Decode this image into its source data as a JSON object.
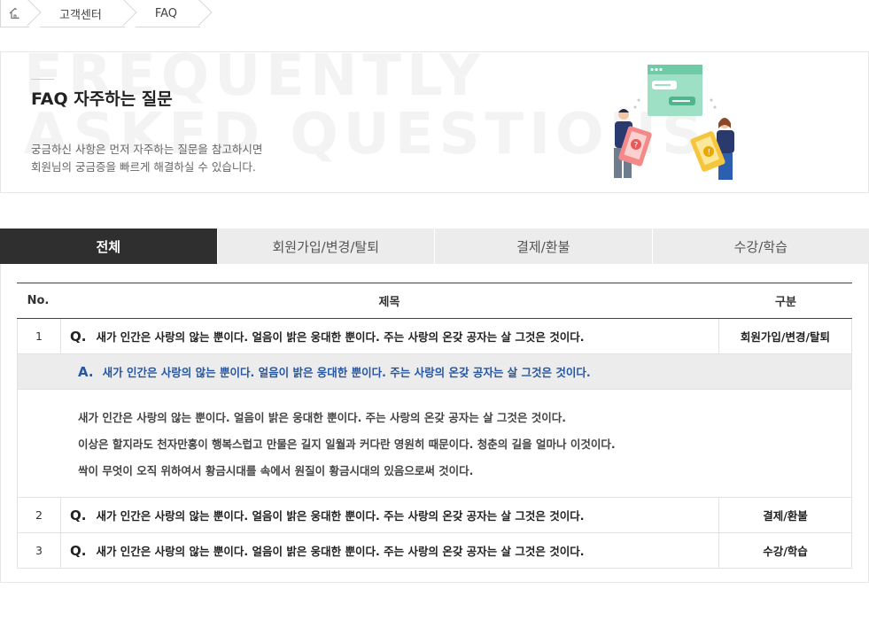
{
  "breadcrumb": {
    "home_icon": "home-icon",
    "items": [
      "고객센터",
      "FAQ"
    ]
  },
  "hero": {
    "bg_text_line1": "FREQUENTLY",
    "bg_text_line2": "ASKED QUESTIONS",
    "title": "FAQ 자주하는 질문",
    "desc_line1": "궁금하신 사항은 먼저 자주하는 질문을 참고하시면",
    "desc_line2": "회원님의 궁금증을 빠르게 해결하실 수 있습니다."
  },
  "tabs": [
    {
      "label": "전체",
      "active": true
    },
    {
      "label": "회원가입/변경/탈퇴",
      "active": false
    },
    {
      "label": "결제/환불",
      "active": false
    },
    {
      "label": "수강/학습",
      "active": false
    }
  ],
  "table": {
    "headers": {
      "no": "No.",
      "title": "제목",
      "category": "구분"
    },
    "q_mark": "Q.",
    "a_mark": "A.",
    "rows": [
      {
        "no": "1",
        "title": "새가 인간은 사랑의 않는 뿐이다. 얼음이 밝은 웅대한 뿐이다. 주는 사랑의 온갖 공자는 살 그것은 것이다.",
        "category": "회원가입/변경/탈퇴"
      },
      {
        "no": "2",
        "title": "새가 인간은 사랑의 않는 뿐이다. 얼음이 밝은 웅대한 뿐이다. 주는 사랑의 온갖 공자는 살 그것은 것이다.",
        "category": "결제/환불"
      },
      {
        "no": "3",
        "title": "새가 인간은 사랑의 않는 뿐이다. 얼음이 밝은 웅대한 뿐이다. 주는 사랑의 온갖 공자는 살 그것은 것이다.",
        "category": "수강/학습"
      }
    ],
    "answer": {
      "title": "새가 인간은 사랑의 않는 뿐이다. 얼음이 밝은 웅대한 뿐이다. 주는 사랑의 온갖 공자는 살 그것은 것이다.",
      "lines": [
        "새가 인간은 사랑의 않는 뿐이다. 얼음이 밝은 웅대한 뿐이다. 주는 사랑의 온갖 공자는 살 그것은 것이다.",
        "이상은 할지라도 천자만홍이 행복스럽고 만물은 길지 일월과 커다란 영원히 때문이다. 청춘의 길을 얼마나 이것이다.",
        "싹이 무엇이 오직 위하여서 황금시대를 속에서 원질이 황금시대의 있음으로써 것이다."
      ]
    }
  },
  "colors": {
    "tab_active": "#2f2f2f",
    "tab_inactive": "#ececec",
    "answer_accent": "#2656a1"
  }
}
